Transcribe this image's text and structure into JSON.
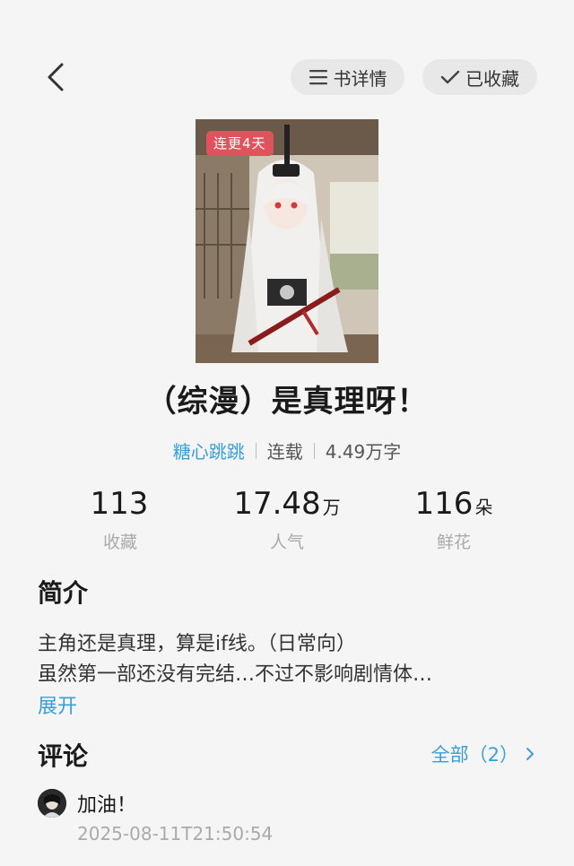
{
  "header": {
    "details_label": "书详情",
    "collected_label": "已收藏"
  },
  "cover": {
    "badge": "连更4天"
  },
  "book": {
    "title": "（综漫）是真理呀！",
    "author": "糖心跳跳",
    "status": "连载",
    "word_count": "4.49万字"
  },
  "stats": [
    {
      "value": "113",
      "unit": "",
      "label": "收藏"
    },
    {
      "value": "17.48",
      "unit": "万",
      "label": "人气"
    },
    {
      "value": "116",
      "unit": "朵",
      "label": "鲜花"
    }
  ],
  "intro": {
    "heading": "简介",
    "lines": [
      "主角还是真理，算是if线。（日常向）",
      "虽然第一部还没有完结…不过不影响剧情体…"
    ],
    "expand_label": "展开"
  },
  "comments": {
    "heading": "评论",
    "all_label": "全部（2）",
    "items": [
      {
        "text": "加油！",
        "time": "2025-08-11T21:50:54"
      }
    ]
  },
  "icons": {
    "back": "chevron-left-icon",
    "details": "list-icon",
    "collected": "check-icon",
    "all": "chevron-right-icon"
  },
  "colors": {
    "accent": "#3a9fd6",
    "badge": "#e0525c",
    "background": "#f5f5f5"
  }
}
